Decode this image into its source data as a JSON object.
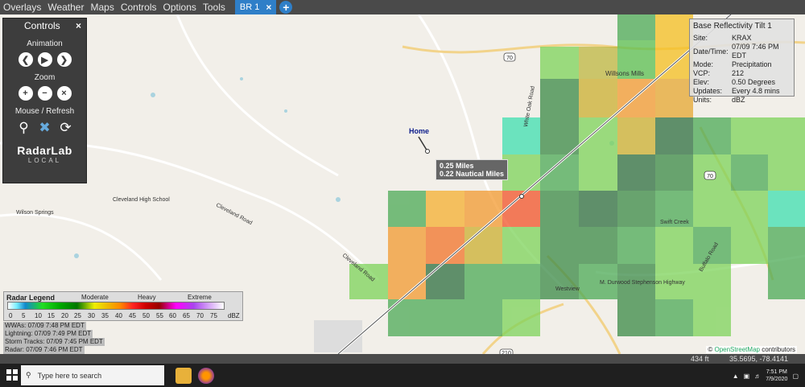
{
  "menu": {
    "items": [
      "Overlays",
      "Weather",
      "Maps",
      "Controls",
      "Options",
      "Tools"
    ],
    "tab_label": "BR 1",
    "tab_close": "×",
    "add_tab": "+"
  },
  "controls": {
    "title": "Controls",
    "close": "×",
    "animation_label": "Animation",
    "zoom_label": "Zoom",
    "mouse_label": "Mouse / Refresh",
    "logo_main": "RadarLab",
    "logo_sub": "LOCAL"
  },
  "info": {
    "title": "Base Reflectivity Tilt 1",
    "rows": [
      {
        "k": "Site:",
        "v": "KRAX"
      },
      {
        "k": "Date/Time:",
        "v": "07/09 7:46 PM EDT"
      },
      {
        "k": "Mode:",
        "v": "Precipitation"
      },
      {
        "k": "VCP:",
        "v": "212"
      },
      {
        "k": "Elev:",
        "v": "0.50 Degrees"
      },
      {
        "k": "Updates:",
        "v": "Every 4.8 mins"
      },
      {
        "k": "Units:",
        "v": "dBZ"
      }
    ]
  },
  "distance": {
    "line1": "0.25 Miles",
    "line2": "0.22 Nautical Miles"
  },
  "marker_label": "Home",
  "legend": {
    "title": "Radar Legend",
    "categories": [
      "Moderate",
      "Heavy",
      "Extreme"
    ],
    "ticks": [
      "0",
      "5",
      "10",
      "15",
      "20",
      "25",
      "30",
      "35",
      "40",
      "45",
      "50",
      "55",
      "60",
      "65",
      "70",
      "75",
      "dBZ"
    ]
  },
  "status": {
    "wwas": "WWAs: 07/09 7:48 PM EDT",
    "lightning": "Lightning: 07/09 7:49 PM EDT",
    "storm_tracks": "Storm Tracks: 07/09 7:45 PM EDT",
    "radar": "Radar: 07/09 7:46 PM EDT"
  },
  "attribution": {
    "prefix": "©",
    "link": "OpenStreetMap",
    "suffix": "contributors"
  },
  "bottombar": {
    "zoom": "434 ft",
    "coords": "35.5695, -78.4141"
  },
  "map_labels": {
    "road_70_a": "70",
    "road_70_b": "70",
    "road_210": "210",
    "willsons_mills": "Willsons Mills",
    "cleveland_road_1": "Cleveland Road",
    "cleveland_road_2": "Cleveland Road",
    "cleveland_high": "Cleveland High School",
    "wilson_springs": "Wilson Springs",
    "westview": "Westview",
    "m_durwood": "M. Durwood Stephenson Highway",
    "buffalo_road": "Buffalo Road",
    "swift_creek": "Swift Creek",
    "white_oak": "White Oak Road"
  },
  "taskbar": {
    "search_placeholder": "Type here to search",
    "time": "7:51 PM",
    "date": "7/9/2020"
  },
  "colors": {
    "menu_bg": "#4a4a4a",
    "tab_blue": "#2f7fc8",
    "panel_bg": "#3d3d3d"
  }
}
